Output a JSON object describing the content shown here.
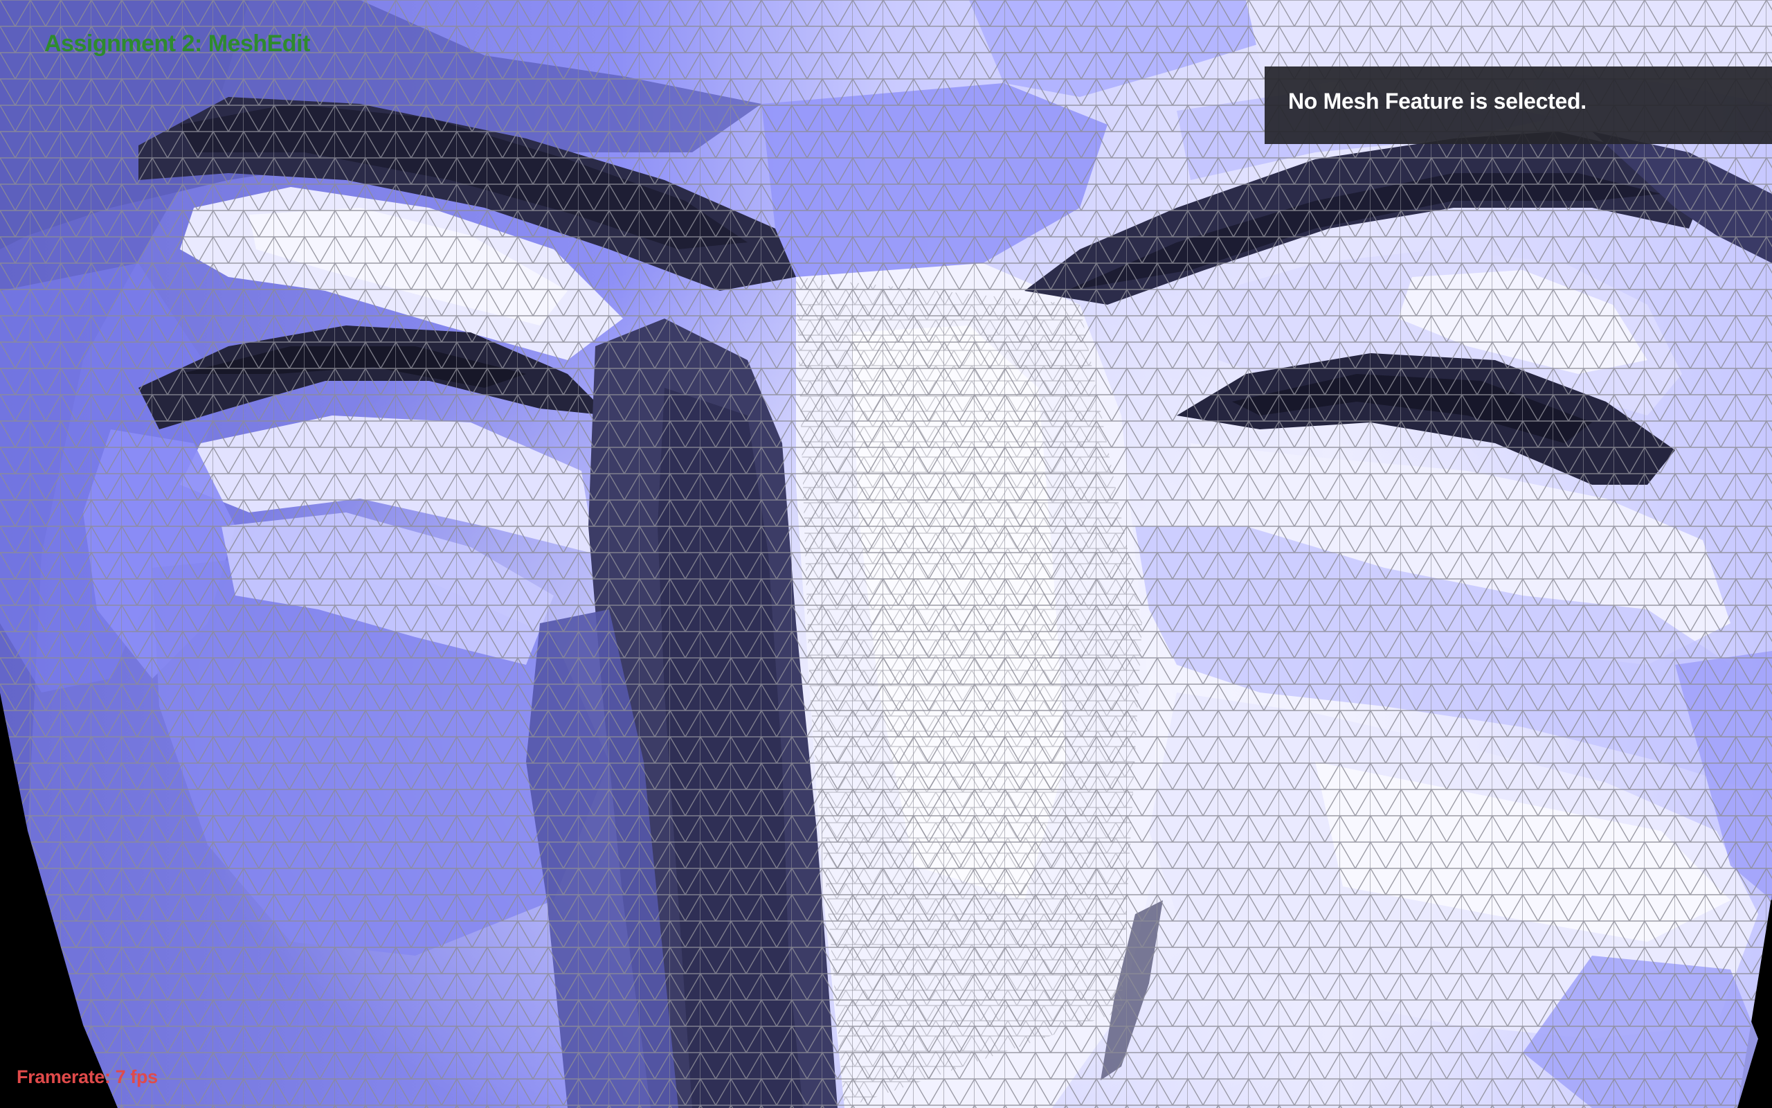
{
  "app": {
    "title": "Assignment 2: MeshEdit"
  },
  "info_panel": {
    "message": "No Mesh Feature is selected."
  },
  "status": {
    "framerate_label": "Framerate:",
    "framerate_value": "7 fps"
  },
  "colors": {
    "background": "#000000",
    "title_green": "#2e8b2e",
    "framerate_red": "#e04a4a",
    "mesh_base": "#8a8cf5",
    "mesh_highlight": "#f2f2ff",
    "mesh_shadow": "#24243a",
    "wireframe": "#8c8c96",
    "panel_bg": "#26262c"
  }
}
